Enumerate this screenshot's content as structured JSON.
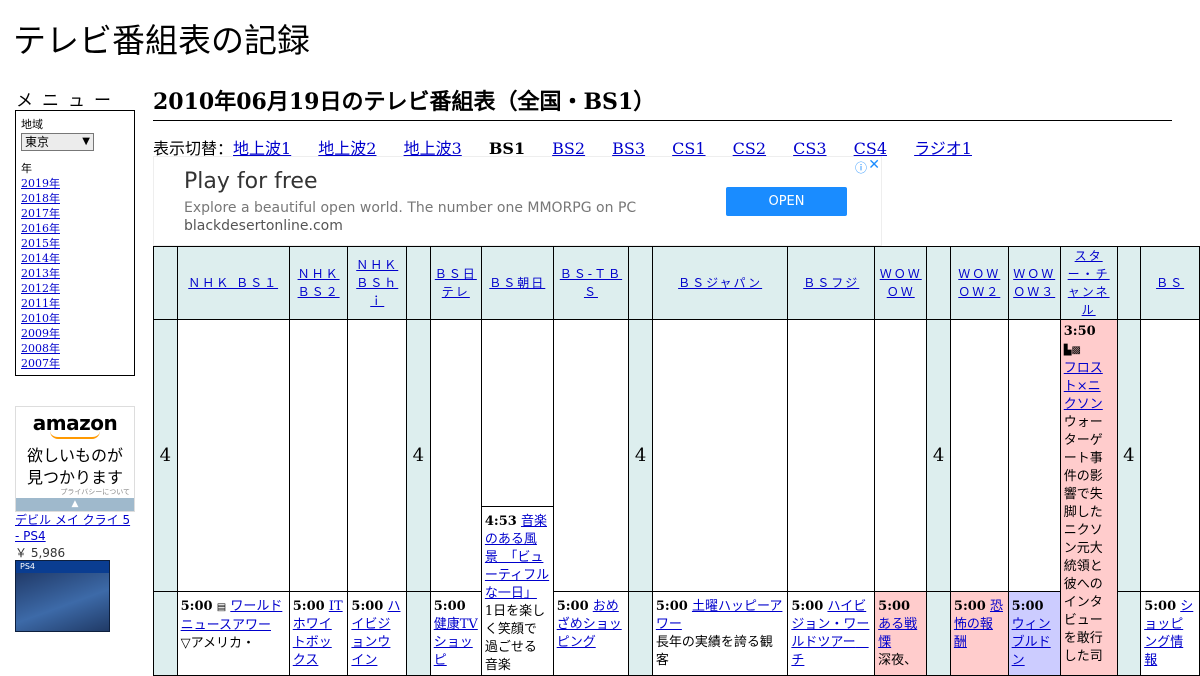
{
  "site_title": "テレビ番組表の記録",
  "menu": {
    "title": "メニュー",
    "region_label": "地域",
    "region_value": "東京",
    "year_label": "年",
    "years": [
      "2019年",
      "2018年",
      "2017年",
      "2016年",
      "2015年",
      "2014年",
      "2013年",
      "2012年",
      "2011年",
      "2010年",
      "2009年",
      "2008年",
      "2007年"
    ]
  },
  "amazon_ad": {
    "logo": "amazon",
    "message_line1": "欲しいものが",
    "message_line2": "見つかります",
    "privacy": "プライバシーについて",
    "product_name": "デビル メイ クライ 5 - PS4",
    "product_price": "￥ 5,986",
    "box_label": "PS4"
  },
  "page_heading": "2010年06月19日のテレビ番組表（全国・BS1）",
  "switcher": {
    "prefix": "表示切替：",
    "current": "BS1",
    "links": [
      "地上波1",
      "地上波2",
      "地上波3",
      "BS1",
      "BS2",
      "BS3",
      "CS1",
      "CS2",
      "CS3",
      "CS4",
      "ラジオ1"
    ]
  },
  "banner_ad": {
    "title": "Play for free",
    "description": "Explore a beautiful open world. The number one MMORPG on PC",
    "url": "blackdesertonline.com",
    "button": "OPEN"
  },
  "table": {
    "hour": "4",
    "channels": [
      "ＮＨＫ ＢＳ１",
      "ＮＨＫ ＢＳ２",
      "ＮＨＫ ＢＳｈｉ",
      "ＢＳ日テレ",
      "ＢＳ朝日",
      "ＢＳ-ＴＢＳ",
      "ＢＳジャパン",
      "ＢＳフジ",
      "ＷＯＷＯＷ",
      "ＷＯＷＯＷ２",
      "ＷＯＷＯＷ３",
      "スター・チャンネル",
      "ＢＳ"
    ],
    "programs": {
      "asahi_453": {
        "time": "4:53",
        "title": "音楽のある風景　「ビューティフルな一日」",
        "desc": "1日を楽しく笑顔で過ごせる音楽"
      },
      "star_350": {
        "time": "3:50",
        "title": "フロスト×ニクソン",
        "desc": "ウォーターゲート事件の影響で失脚したニクソン元大統領と彼へのインタビューを敢行した司"
      },
      "nhkbs1_500": {
        "time": "5:00",
        "title": "ワールドニュースアワー",
        "desc": "▽アメリカ・"
      },
      "nhkbs2_500": {
        "time": "5:00",
        "title": "ITホワイトボックス"
      },
      "bshi_500": {
        "time": "5:00",
        "title": "ハイビジョンウイン"
      },
      "ntv_500": {
        "time": "5:00",
        "title": "健康TVショッピ"
      },
      "tbs_500": {
        "time": "5:00",
        "title": "おめざめショッピング"
      },
      "japan_500": {
        "time": "5:00",
        "title": "土曜ハッピーアワー",
        "desc": "長年の実績を誇る観客"
      },
      "fuji_500": {
        "time": "5:00",
        "title": "ハイビジョン・ワールドツアー　チ"
      },
      "wowow_500": {
        "time": "5:00",
        "title": "ある戦慄",
        "desc": "深夜、"
      },
      "wowow2_500": {
        "time": "5:00",
        "title": "恐怖の報酬"
      },
      "wowow3_500": {
        "time": "5:00",
        "title": "ウィンブルドン"
      },
      "bs_last_500": {
        "time": "5:00",
        "title": "ショッピング情報"
      }
    }
  }
}
